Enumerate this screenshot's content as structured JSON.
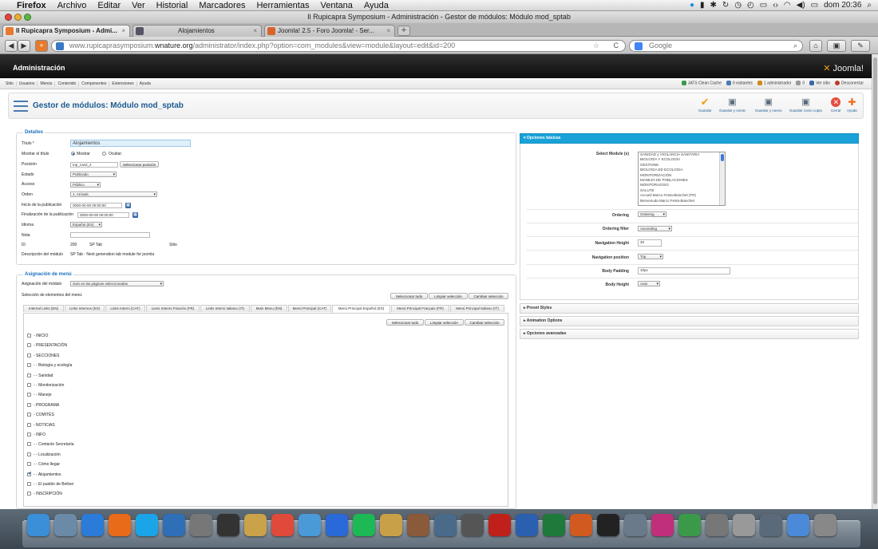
{
  "menubar": {
    "app": "Firefox",
    "items": [
      "Archivo",
      "Editar",
      "Ver",
      "Historial",
      "Marcadores",
      "Herramientas",
      "Ventana",
      "Ayuda"
    ],
    "clock": "dom 20:36"
  },
  "window": {
    "title": "Il Rupicapra Symposium - Administración - Gestor de módulos: Módulo mod_sptab"
  },
  "tabs": [
    {
      "label": "Il Rupicapra Symposium - Admi...",
      "active": true
    },
    {
      "label": "Alojamientos",
      "active": false
    },
    {
      "label": "Joomla! 2.5 - Foro Joomla! - Ser...",
      "active": false
    }
  ],
  "nav": {
    "url_prefix": "www.rupicaprasymposium.",
    "url_domain": "wnature.org",
    "url_path": "/administrator/index.php?option=com_modules&view=module&layout=edit&id=200",
    "search_placeholder": "Google"
  },
  "admin": {
    "header": "Administración",
    "logo_mark": "✕",
    "logo_text": "Joomla!",
    "menu": [
      "Sitio",
      "Usuarios",
      "Menús",
      "Contenido",
      "Componentes",
      "Extensiones",
      "Ayuda"
    ],
    "status": [
      "JATS Clean Cache",
      "0 visitantes",
      "1 administrador",
      "0",
      "Ver sitio",
      "Desconectar"
    ]
  },
  "page": {
    "title": "Gestor de módulos: Módulo mod_sptab",
    "toolbar": [
      {
        "label": "Guardar",
        "icon": "check-icon"
      },
      {
        "label": "Guardar y cerrar",
        "icon": "save-icon"
      },
      {
        "label": "Guardar y nuevo",
        "icon": "save-new-icon"
      },
      {
        "label": "Guardar como copia",
        "icon": "save-copy-icon"
      },
      {
        "label": "Cerrar",
        "icon": "close-icon"
      },
      {
        "label": "Ayuda",
        "icon": "help-icon"
      }
    ]
  },
  "details": {
    "legend": "Detalles",
    "title_label": "Título *",
    "title_value": "Alojamientos",
    "show_title_label": "Mostrar el título",
    "show_option": "Mostrar",
    "hide_option": "Ocultar",
    "position_label": "Posición",
    "position_value": "top_row3_2",
    "position_button": "Seleccionar posición",
    "state_label": "Estado",
    "state_value": "Publicado",
    "access_label": "Acceso",
    "access_value": "Público",
    "order_label": "Orden",
    "order_value": "1. Arrivals",
    "publish_up_label": "Inicio de la publicación",
    "publish_up_value": "0000-00-00 00:00:00",
    "publish_down_label": "Finalización de la publicación",
    "publish_down_value": "0000-00-00 00:00:00",
    "language_label": "Idioma",
    "language_value": "Español (ES)",
    "note_label": "Nota",
    "note_value": "",
    "id_label": "ID",
    "id_value": "200",
    "module_type": "SP Tab",
    "site_label": "Sitio",
    "description_label": "Descripción del módulo",
    "description_value": "SP Tab - Next generation tab module for joomla"
  },
  "assignment": {
    "legend": "Asignación de menú",
    "module_assignment_label": "Asignación del módulo",
    "module_assignment_value": "Solo en las páginas seleccionadas",
    "menu_selection_label": "Selección de elementos del menú:",
    "buttons": [
      "Seleccionar todo",
      "Limpiar selección",
      "Cambiar selección"
    ],
    "menu_tabs": [
      "Internal Links (EN)",
      "Links Internos (ES)",
      "Links Interni (CAT)",
      "Liens Interns Francés (FR)",
      "Links Interni Italiano (IT)",
      "Main Menu (EN)",
      "Menú Principal (CAT)",
      "Menú Principal Español (ES)",
      "Menú Principal Français (FR)",
      "Menú Principal Italiano (IT)"
    ],
    "active_tab_index": 7,
    "items": [
      {
        "label": "- INICIO",
        "checked": false
      },
      {
        "label": "- PRESENTACIÓN",
        "checked": false
      },
      {
        "label": "- SECCIONES",
        "checked": false
      },
      {
        "label": "- - Biología y ecología",
        "checked": false
      },
      {
        "label": "- - Sanidad",
        "checked": false
      },
      {
        "label": "- - Monitorización",
        "checked": false
      },
      {
        "label": "- - Manejo",
        "checked": false
      },
      {
        "label": "- PROGRAMA",
        "checked": false
      },
      {
        "label": "- COMITÉS",
        "checked": false
      },
      {
        "label": "- NOTICIAS",
        "checked": false
      },
      {
        "label": "- INFO",
        "checked": false
      },
      {
        "label": "- - Contacto Secretaría",
        "checked": false
      },
      {
        "label": "- - Localización",
        "checked": false
      },
      {
        "label": "- - Cómo llegar",
        "checked": false
      },
      {
        "label": "- - Alojamientos",
        "checked": true
      },
      {
        "label": "- - El pueblo de Bellver",
        "checked": false
      },
      {
        "label": "- INSCRIPCIÓN",
        "checked": false
      }
    ]
  },
  "options": {
    "basic_title": "Opciones básicas",
    "select_module_label": "Select Module (s)",
    "modules_list": [
      "SANIDAD y VIGILANCIA SANITARIA",
      "BIOLOGÍA Y ECOLOGÍA",
      "GESTIONE",
      "BIOLOGIA ED ECOLOGIA",
      "MONITORIZACIÓN",
      "MANEJO DE POBLACIONES",
      "MONITORAGGIO",
      "SALUTE",
      "Accueil Marco Festa-Bianchet (FR)",
      "Benvenuda Marco Festa-Bianchet"
    ],
    "ordering_label": "Ordering",
    "ordering_value": "Ordering",
    "ordering_filter_label": "Ordering filter",
    "ordering_filter_value": "Ascending",
    "nav_height_label": "Navigation Height",
    "nav_height_value": "30",
    "nav_position_label": "Navigation position",
    "nav_position_value": "Top",
    "body_padding_label": "Body Padding",
    "body_padding_value": "10px",
    "body_height_label": "Body Height",
    "body_height_value": "Auto",
    "preset_styles": "Preset Styles",
    "animation_options": "Animation Options",
    "advanced_options": "Opciones avanzadas"
  },
  "dock": {
    "apps": [
      "Finder",
      "Vista Previa",
      "Safari",
      "Firefox",
      "Skype",
      "Google Earth",
      "FaceTime",
      "Dashboard",
      "Contactos",
      "iCal",
      "Mail",
      "iTunes",
      "Spotify",
      "Photo",
      "Aperture",
      "Mission Control",
      "Time Machine",
      "Acrobat",
      "Word",
      "Excel",
      "PowerPoint",
      "Terminal",
      "Utilidades",
      "InDesign",
      "Numbers",
      "Preferencias",
      "Impresora",
      "Captura",
      "Descargas",
      "Papelera"
    ]
  },
  "colors": {
    "accent": "#1aa1d8",
    "link": "#1a6fbf",
    "joomla_header": "#1a1a1a",
    "save_check": "#f39c12",
    "close_red": "#e74c3c"
  }
}
